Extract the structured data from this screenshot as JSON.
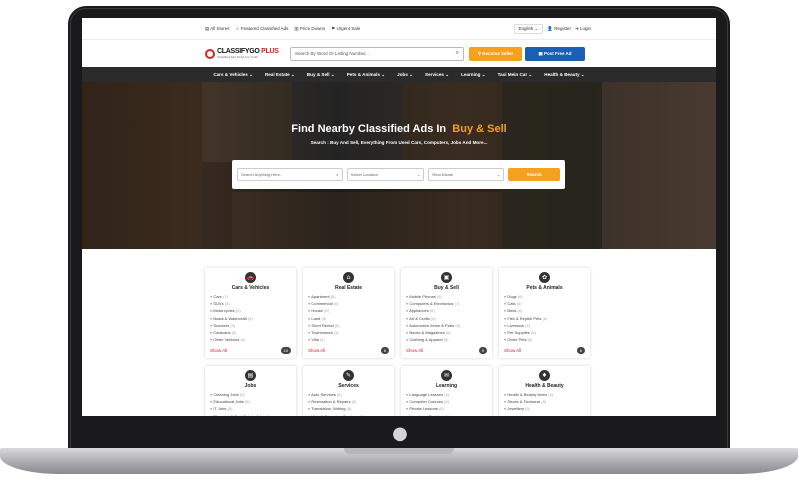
{
  "topbar": {
    "links": [
      "All Stores",
      "Featured Classified Ads",
      "Price Downs",
      "Urgent Sale"
    ],
    "language": "English",
    "register": "Register",
    "login": "Login"
  },
  "header": {
    "logo_main": "CLASSIFYGO",
    "logo_accent": " PLUS",
    "logo_sub": "Classified Ads Script For Youth",
    "search_placeholder": "Search By Word Or Listing Number...",
    "sell_label": "Become Seller",
    "post_label": "Post Free Ad"
  },
  "nav": [
    "Cars & Vehicles",
    "Real Estate",
    "Buy & Sell",
    "Pets & Animals",
    "Jobs",
    "Services",
    "Learning",
    "Taxi Mein Car",
    "Health & Beauty"
  ],
  "hero": {
    "title": "Find Nearby Classified Ads In",
    "title_accent": "Buy & Sell",
    "subtitle": "Search : Buy And Sell, Everything From Used Cars, Computers, Jobs And More...",
    "search_placeholder": "Search Anything Here...",
    "location_label": "Select Location",
    "category_label": "Real Estate",
    "search_button": "Search"
  },
  "categories": [
    {
      "title": "Cars & Vehicles",
      "icon": "car-icon",
      "items": [
        [
          "Cars",
          "(7)"
        ],
        [
          "SUVs",
          "(3)"
        ],
        [
          "Motorcycles",
          "(4)"
        ],
        [
          "Boats & Watercraft",
          "(6)"
        ],
        [
          "Scooters",
          "(6)"
        ],
        [
          "Caravans",
          "(6)"
        ],
        [
          "Other Vehicles",
          "(6)"
        ]
      ],
      "show_all": "Show All",
      "count": "10"
    },
    {
      "title": "Real Estate",
      "icon": "house-icon",
      "items": [
        [
          "Apartment",
          "(6)"
        ],
        [
          "Commercial",
          "(6)"
        ],
        [
          "House",
          "(6)"
        ],
        [
          "Land",
          "(6)"
        ],
        [
          "Short Rental",
          "(6)"
        ],
        [
          "Townhomes",
          "(1)"
        ],
        [
          "Villa",
          "(6)"
        ]
      ],
      "show_all": "Show All",
      "count": "8"
    },
    {
      "title": "Buy & Sell",
      "icon": "shopping-bag-icon",
      "items": [
        [
          "Mobile Phones",
          "(6)"
        ],
        [
          "Computers & Electronics",
          "(7)"
        ],
        [
          "Appliances",
          "(6)"
        ],
        [
          "Art & Crafts",
          "(6)"
        ],
        [
          "Automotive Items & Parts",
          "(6)"
        ],
        [
          "Books & Magazines",
          "(6)"
        ],
        [
          "Clothing & Apparel",
          "(6)"
        ]
      ],
      "show_all": "Show All",
      "count": "9"
    },
    {
      "title": "Pets & Animals",
      "icon": "paw-icon",
      "items": [
        [
          "Dogs",
          "(6)"
        ],
        [
          "Cats",
          "(6)"
        ],
        [
          "Birds",
          "(6)"
        ],
        [
          "Fish & Reptile Pets",
          "(6)"
        ],
        [
          "Livestock",
          "(6)"
        ],
        [
          "Pet Supplies",
          "(6)"
        ],
        [
          "Other Pets",
          "(6)"
        ]
      ],
      "show_all": "Show All",
      "count": "6"
    },
    {
      "title": "Jobs",
      "icon": "briefcase-icon",
      "items": [
        [
          "Cleaning Jobs",
          "(6)"
        ],
        [
          "Educational Jobs",
          "(6)"
        ],
        [
          "IT Jobs",
          "(6)"
        ],
        [
          "Financial & Real Estate Jobs",
          "(6)"
        ]
      ]
    },
    {
      "title": "Services",
      "icon": "wrench-icon",
      "items": [
        [
          "Auto Services",
          "(6)"
        ],
        [
          "Restoration & Repairs",
          "(6)"
        ],
        [
          "Translation, Writing",
          "(6)"
        ],
        [
          "Web & Computer Services",
          "(6)"
        ]
      ]
    },
    {
      "title": "Learning",
      "icon": "chat-icon",
      "items": [
        [
          "Language Lessons",
          "(6)"
        ],
        [
          "Computer Courses",
          "(6)"
        ],
        [
          "Private Lessons",
          "(6)"
        ],
        [
          "Vocational Training",
          "(6)"
        ]
      ]
    },
    {
      "title": "Health & Beauty",
      "icon": "drop-icon",
      "items": [
        [
          "Health & Beauty Items",
          "(6)"
        ],
        [
          "Shoes & Footwear",
          "(6)"
        ],
        [
          "Jewellery",
          "(6)"
        ]
      ]
    }
  ]
}
